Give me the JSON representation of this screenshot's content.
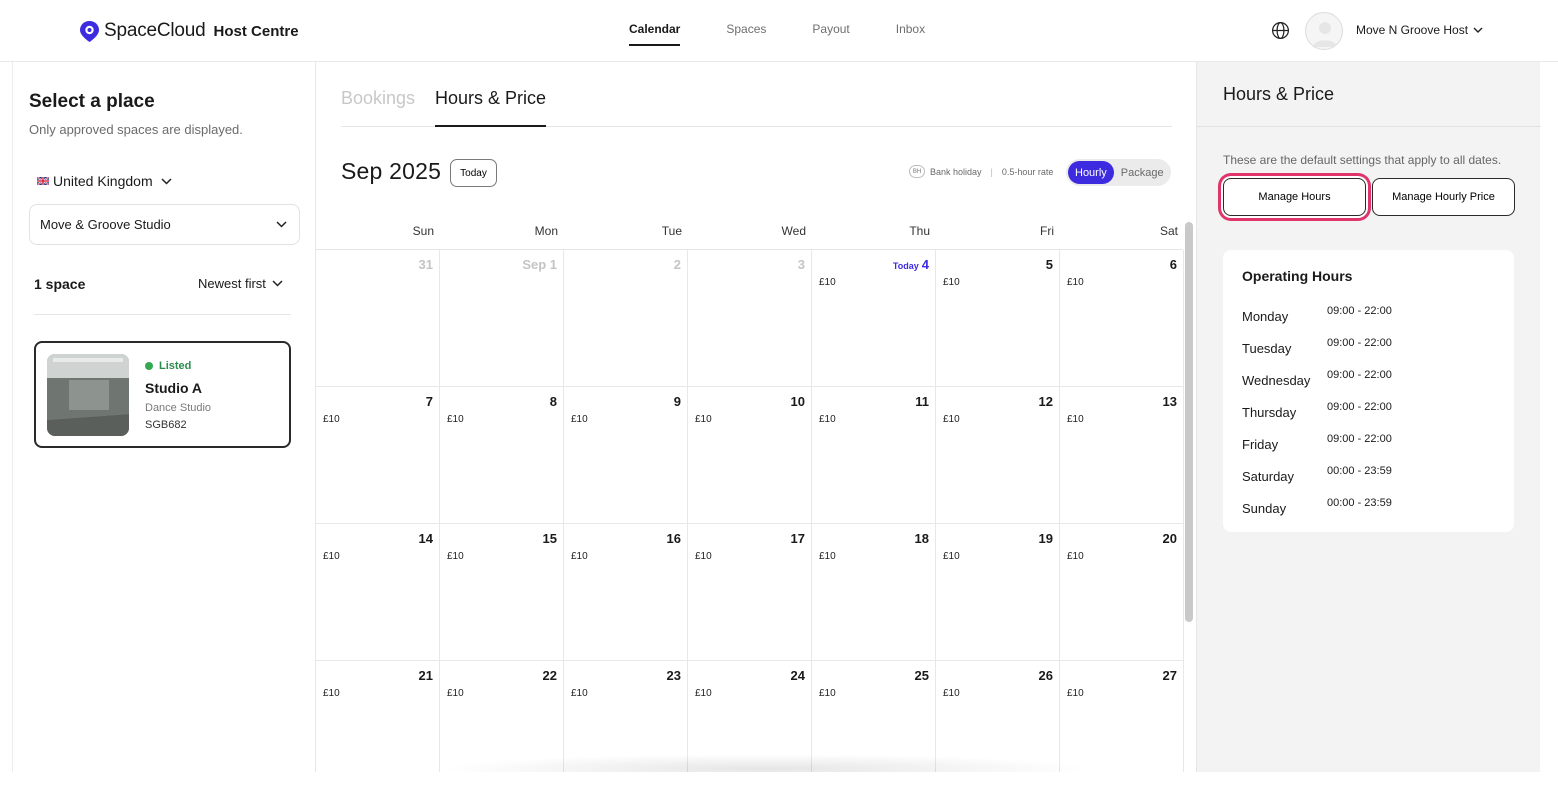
{
  "brand": {
    "name": "SpaceCloud",
    "subtitle": "Host Centre"
  },
  "nav": {
    "tabs": [
      {
        "label": "Calendar",
        "active": true
      },
      {
        "label": "Spaces",
        "active": false
      },
      {
        "label": "Payout",
        "active": false
      },
      {
        "label": "Inbox",
        "active": false
      }
    ],
    "user_name": "Move N Groove Host"
  },
  "sidebar": {
    "title": "Select a place",
    "subtitle": "Only approved spaces are displayed.",
    "country": "United Kingdom",
    "place": "Move & Groove Studio",
    "space_count": "1 space",
    "sort": "Newest first",
    "card": {
      "status": "Listed",
      "name": "Studio A",
      "type": "Dance Studio",
      "code": "SGB682"
    }
  },
  "main": {
    "tabs": [
      "Bookings",
      "Hours & Price"
    ],
    "month": "Sep 2025",
    "today_button": "Today",
    "legend": {
      "bh_badge": "BH",
      "bank_holiday": "Bank holiday",
      "half_hour": "0.5-hour rate"
    },
    "toggle": {
      "hourly": "Hourly",
      "package": "Package",
      "selected": "Hourly"
    },
    "weekdays": [
      "Sun",
      "Mon",
      "Tue",
      "Wed",
      "Thu",
      "Fri",
      "Sat"
    ],
    "today_label": "Today",
    "weeks": [
      [
        {
          "day": "31",
          "price": "",
          "muted": true
        },
        {
          "day": "Sep 1",
          "price": "",
          "muted": true
        },
        {
          "day": "2",
          "price": "",
          "muted": true
        },
        {
          "day": "3",
          "price": "",
          "muted": true
        },
        {
          "day": "4",
          "price": "£10",
          "today": true
        },
        {
          "day": "5",
          "price": "£10"
        },
        {
          "day": "6",
          "price": "£10"
        }
      ],
      [
        {
          "day": "7",
          "price": "£10"
        },
        {
          "day": "8",
          "price": "£10"
        },
        {
          "day": "9",
          "price": "£10"
        },
        {
          "day": "10",
          "price": "£10"
        },
        {
          "day": "11",
          "price": "£10"
        },
        {
          "day": "12",
          "price": "£10"
        },
        {
          "day": "13",
          "price": "£10"
        }
      ],
      [
        {
          "day": "14",
          "price": "£10"
        },
        {
          "day": "15",
          "price": "£10"
        },
        {
          "day": "16",
          "price": "£10"
        },
        {
          "day": "17",
          "price": "£10"
        },
        {
          "day": "18",
          "price": "£10"
        },
        {
          "day": "19",
          "price": "£10"
        },
        {
          "day": "20",
          "price": "£10"
        }
      ],
      [
        {
          "day": "21",
          "price": "£10"
        },
        {
          "day": "22",
          "price": "£10"
        },
        {
          "day": "23",
          "price": "£10"
        },
        {
          "day": "24",
          "price": "£10"
        },
        {
          "day": "25",
          "price": "£10"
        },
        {
          "day": "26",
          "price": "£10"
        },
        {
          "day": "27",
          "price": "£10"
        }
      ]
    ]
  },
  "panel": {
    "title": "Hours & Price",
    "description": "These are the default settings that apply to all dates.",
    "manage_hours": "Manage Hours",
    "manage_price": "Manage Hourly Price",
    "operating_title": "Operating Hours",
    "hours": [
      {
        "day": "Monday",
        "time": "09:00 - 22:00"
      },
      {
        "day": "Tuesday",
        "time": "09:00 - 22:00"
      },
      {
        "day": "Wednesday",
        "time": "09:00 - 22:00"
      },
      {
        "day": "Thursday",
        "time": "09:00 - 22:00"
      },
      {
        "day": "Friday",
        "time": "09:00 - 22:00"
      },
      {
        "day": "Saturday",
        "time": "00:00 - 23:59"
      },
      {
        "day": "Sunday",
        "time": "00:00 - 23:59"
      }
    ]
  },
  "colors": {
    "accent": "#3d2be0",
    "highlight": "#e0356b",
    "listed": "#34a853"
  }
}
